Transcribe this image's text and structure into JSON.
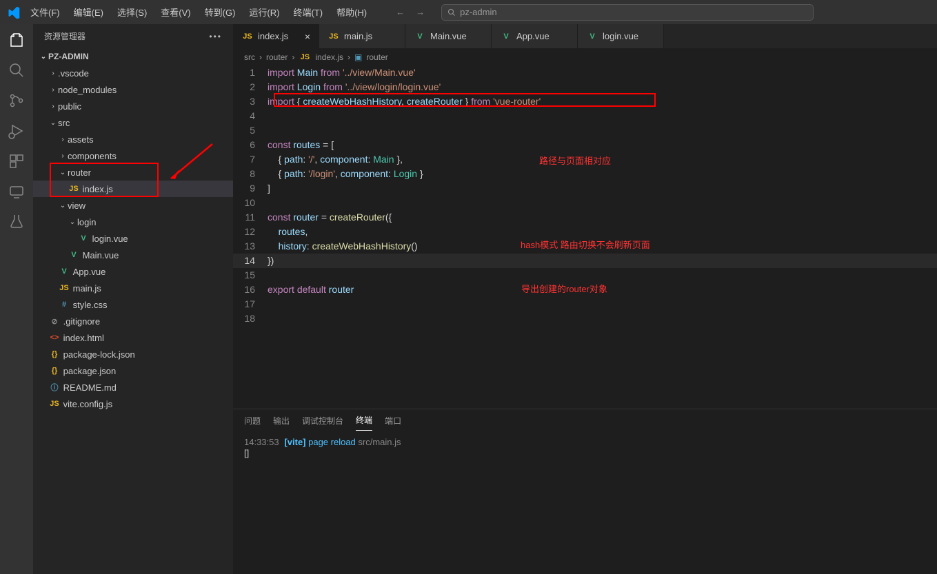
{
  "menu": {
    "file": "文件(F)",
    "edit": "编辑(E)",
    "select": "选择(S)",
    "view": "查看(V)",
    "goto": "转到(G)",
    "run": "运行(R)",
    "terminal": "终端(T)",
    "help": "帮助(H)"
  },
  "search_value": "pz-admin",
  "explorer": {
    "title": "资源管理器",
    "project": "PZ-ADMIN"
  },
  "tree": {
    "vscode": ".vscode",
    "node_modules": "node_modules",
    "public": "public",
    "src": "src",
    "assets": "assets",
    "components": "components",
    "router": "router",
    "router_index": "index.js",
    "view": "view",
    "login": "login",
    "login_vue": "login.vue",
    "main_vue": "Main.vue",
    "app_vue": "App.vue",
    "main_js": "main.js",
    "style_css": "style.css",
    "gitignore": ".gitignore",
    "index_html": "index.html",
    "pkg_lock": "package-lock.json",
    "pkg": "package.json",
    "readme": "README.md",
    "vite_config": "vite.config.js"
  },
  "tabs": {
    "t0": "index.js",
    "t1": "main.js",
    "t2": "Main.vue",
    "t3": "App.vue",
    "t4": "login.vue"
  },
  "breadcrumb": {
    "p0": "src",
    "p1": "router",
    "p2": "index.js",
    "p3": "router"
  },
  "code": {
    "l1": {
      "a": "import",
      "b": "Main",
      "c": "from",
      "d": "'../view/Main.vue'"
    },
    "l2": {
      "a": "import",
      "b": "Login",
      "c": "from",
      "d": "'../view/login/login.vue'"
    },
    "l3": {
      "a": "import",
      "b": "{ ",
      "c": "createWebHashHistory",
      "d": ", ",
      "e": "createRouter",
      "f": " }",
      "g": "from",
      "h": "'vue-router'"
    },
    "l6": {
      "a": "const",
      "b": "routes",
      "c": " = ["
    },
    "l7": {
      "a": "    { ",
      "b": "path",
      "c": ": ",
      "d": "'/'",
      "e": ", ",
      "f": "component",
      "g": ": ",
      "h": "Main",
      "i": " },"
    },
    "l8": {
      "a": "    { ",
      "b": "path",
      "c": ": ",
      "d": "'/login'",
      "e": ", ",
      "f": "component",
      "g": ": ",
      "h": "Login",
      "i": " }"
    },
    "l9": "]",
    "l11": {
      "a": "const",
      "b": "router",
      "c": " = ",
      "d": "createRouter",
      "e": "({"
    },
    "l12": {
      "a": "    ",
      "b": "routes",
      "c": ","
    },
    "l13": {
      "a": "    ",
      "b": "history",
      "c": ": ",
      "d": "createWebHashHistory",
      "e": "()"
    },
    "l14": "})",
    "l16": {
      "a": "export",
      "b": "default",
      "c": "router"
    }
  },
  "annotations": {
    "a1": "路径与页面相对应",
    "a2": "hash模式 路由切换不会刷新页面",
    "a3": "导出创建的router对象"
  },
  "terminal": {
    "tabs": {
      "problems": "问题",
      "output": "输出",
      "debug": "调试控制台",
      "term": "终端",
      "ports": "端口"
    },
    "time": "14:33:53",
    "vite": "[vite]",
    "msg": " page reload ",
    "file": "src/main.js",
    "cursor": "[]"
  }
}
